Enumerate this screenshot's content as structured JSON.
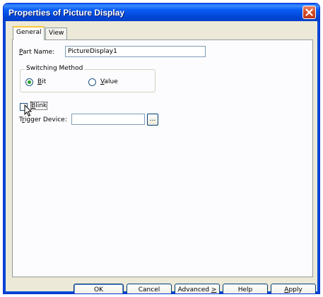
{
  "window": {
    "title": "Properties of Picture Display"
  },
  "tabs": [
    {
      "label": "General",
      "active": true
    },
    {
      "label": "View",
      "active": false
    }
  ],
  "general": {
    "part_name": {
      "label_u": "P",
      "label_rest": "art Name:",
      "value": "PictureDisplay1"
    },
    "switching_method": {
      "legend": "Switching Method",
      "options": [
        {
          "label_u": "B",
          "label_rest": "it",
          "checked": true
        },
        {
          "label_u": "V",
          "label_rest": "alue",
          "checked": false
        }
      ]
    },
    "blink": {
      "label_u": "B",
      "label_rest": "link",
      "checked": false
    },
    "trigger_device": {
      "label_pre": "T",
      "label_u": "r",
      "label_rest": "igger Device:",
      "value": "",
      "browse_label": "..."
    }
  },
  "buttons": {
    "ok": "OK",
    "cancel": "Cancel",
    "advanced_pre": "Advanced ",
    "advanced_u": ">",
    "help": "Help",
    "apply_u": "A",
    "apply_rest": "pply"
  },
  "colors": {
    "title_bar": "#0a5cf5",
    "dialog_face": "#ece9d8",
    "panel": "#fcfcfe",
    "active_tab_accent": "#ffc83c"
  },
  "icons": {
    "close": "close-icon",
    "cursor": "mouse-pointer-icon"
  }
}
